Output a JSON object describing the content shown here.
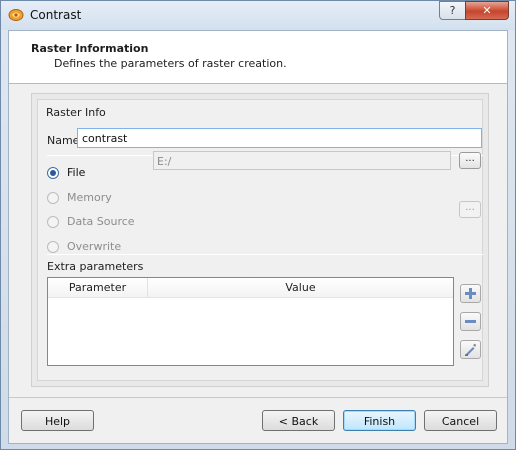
{
  "window": {
    "title": "Contrast",
    "close_label": "✕",
    "help_label": "?"
  },
  "header": {
    "title": "Raster Information",
    "subtitle": "Defines the parameters of raster creation."
  },
  "raster_info": {
    "group_label": "Raster Info",
    "name_label": "Name",
    "name_value": "contrast",
    "file_path": "E:/",
    "browse_label": "...",
    "options": [
      {
        "label": "File",
        "selected": true,
        "enabled": true
      },
      {
        "label": "Memory",
        "selected": false,
        "enabled": false
      },
      {
        "label": "Data Source",
        "selected": false,
        "enabled": false
      },
      {
        "label": "Overwrite",
        "selected": false,
        "enabled": false
      }
    ]
  },
  "extra": {
    "label": "Extra parameters",
    "columns": [
      "Parameter",
      "Value"
    ],
    "rows": [],
    "add_icon": "plus-icon",
    "remove_icon": "minus-icon",
    "edit_icon": "edit-icon"
  },
  "footer": {
    "help": "Help",
    "back": "< Back",
    "finish": "Finish",
    "cancel": "Cancel"
  },
  "colors": {
    "accent": "#3c7fb1",
    "close": "#c7442c"
  }
}
